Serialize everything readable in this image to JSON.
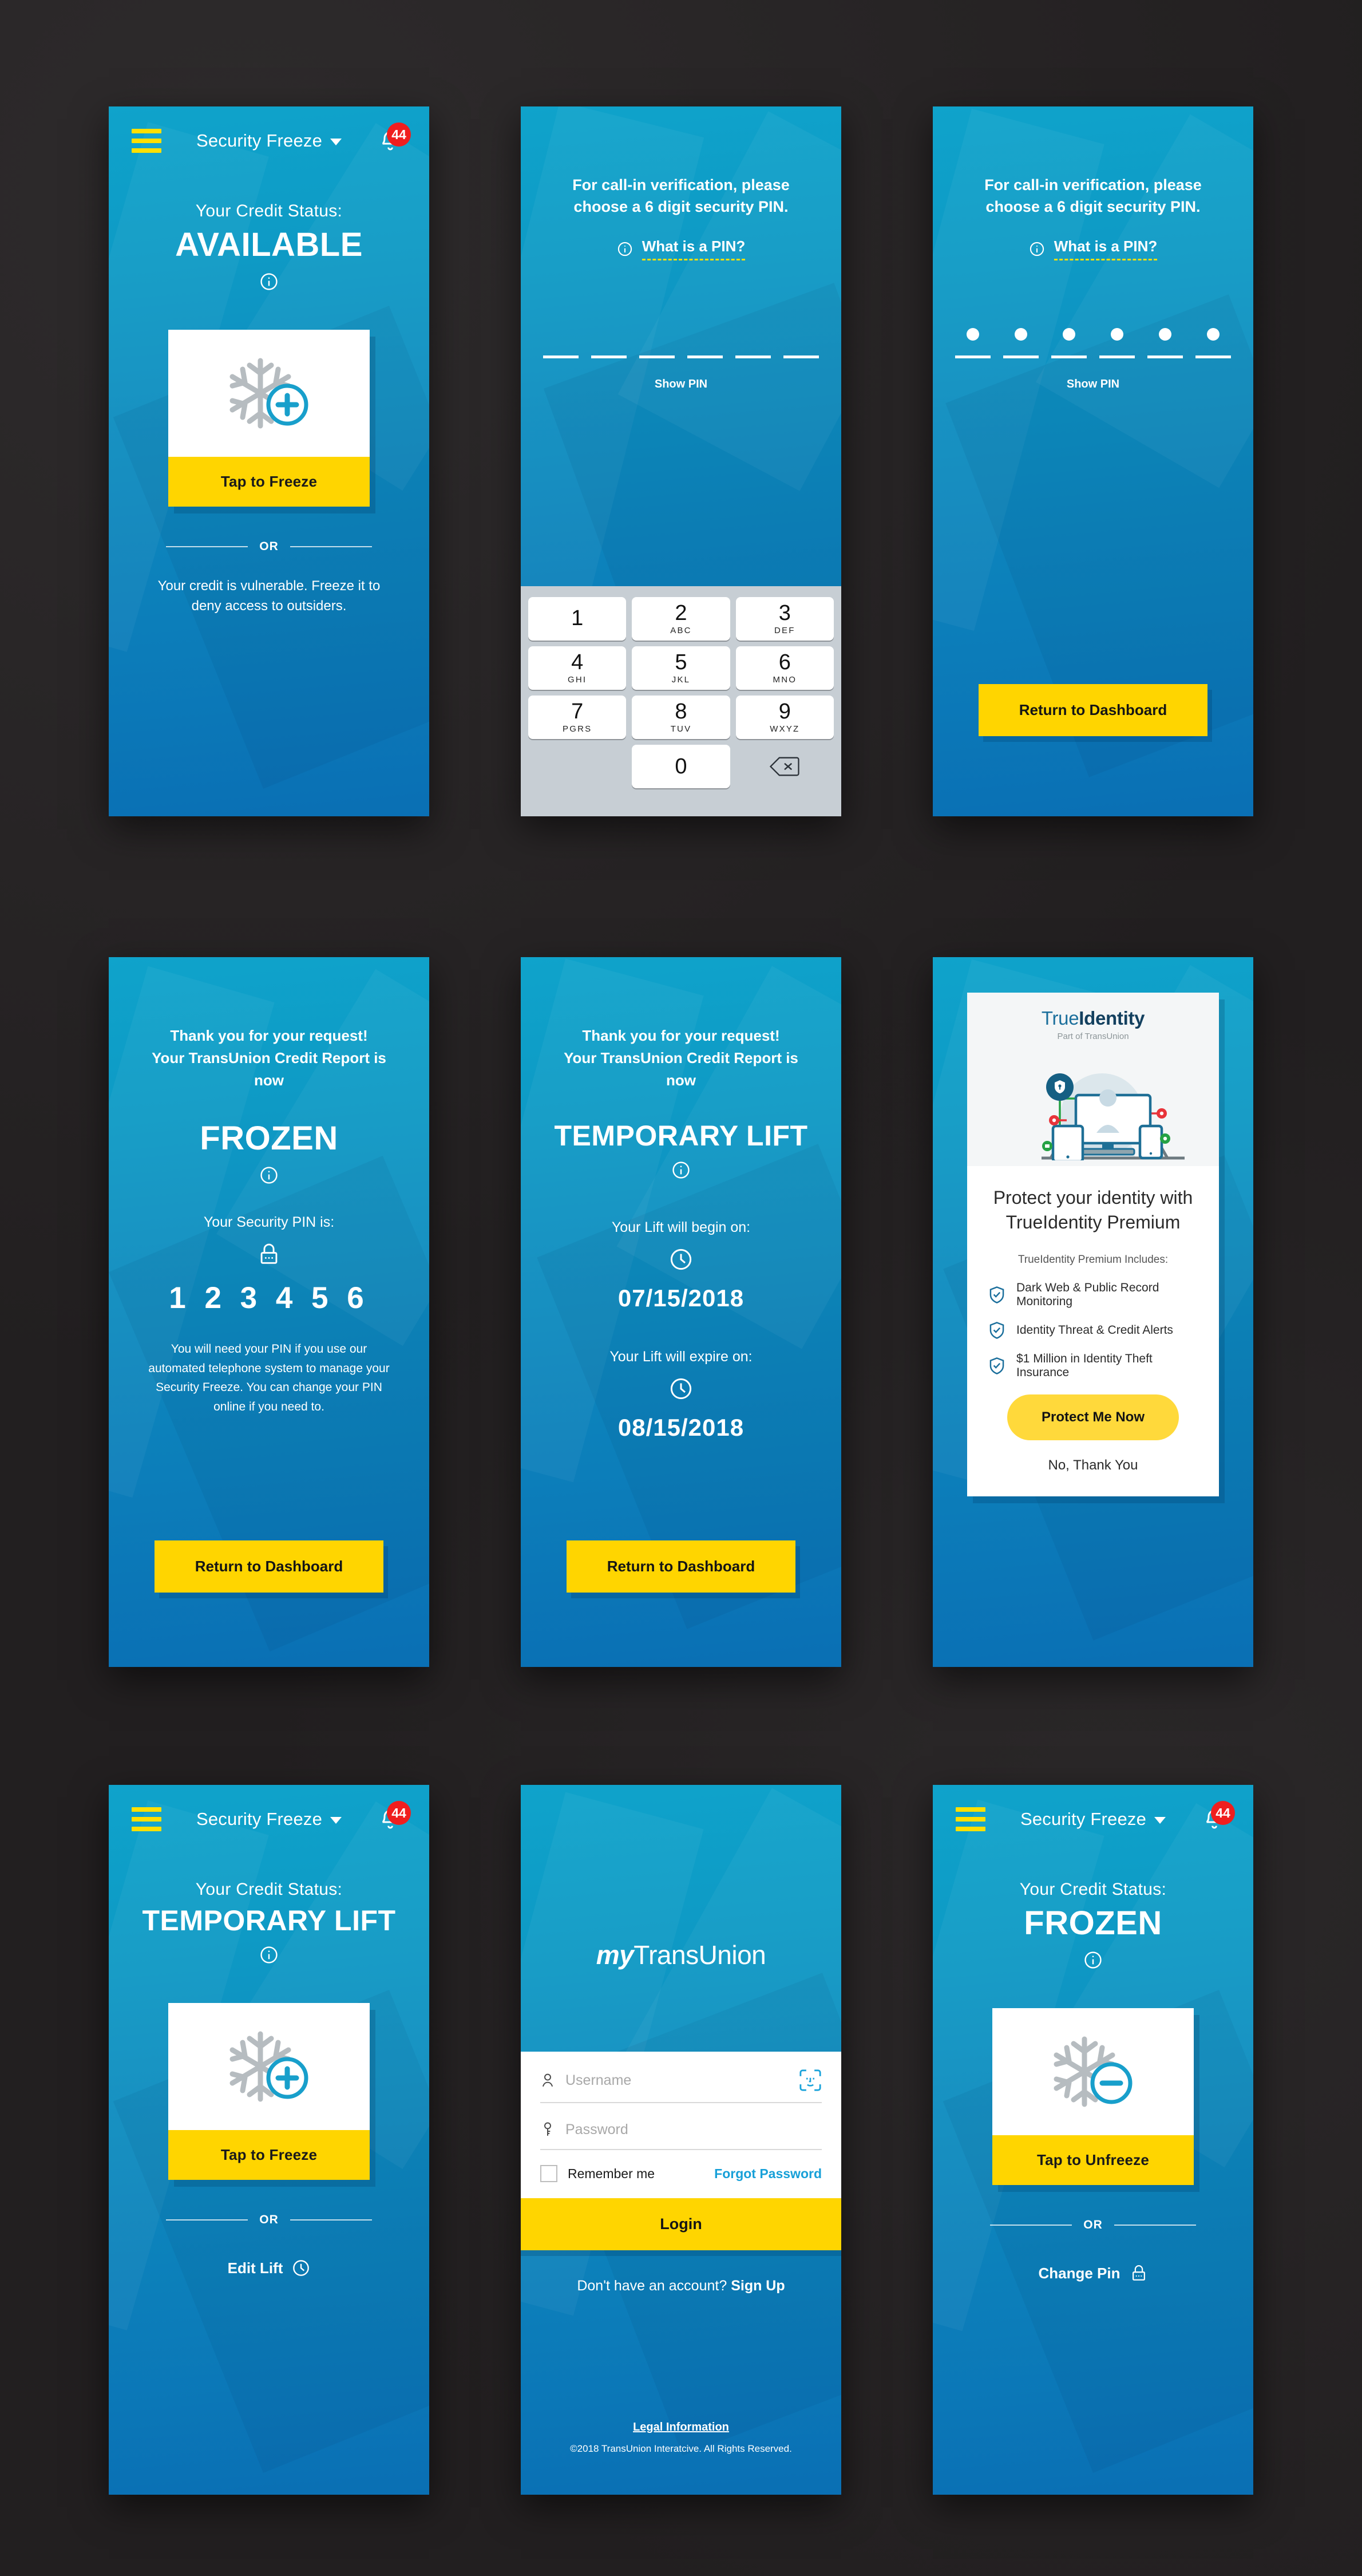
{
  "colors": {
    "teal_top": "#0FA3CB",
    "blue_bottom": "#0A6FB4",
    "yellow": "#FFD500",
    "yellow_menu": "#FFE000",
    "badge_red": "#F01E1E",
    "link_blue": "#17A0D8"
  },
  "nav": {
    "title": "Security Freeze",
    "menu_icon": "hamburger-icon",
    "caret_icon": "chevron-down-icon",
    "bell_icon": "bell-icon",
    "badge_count": "44"
  },
  "common": {
    "status_label": "Your Credit Status:",
    "or": "OR",
    "info_icon": "info-circle-icon",
    "return_dashboard": "Return to Dashboard",
    "thanks_line1": "Thank you for your request!",
    "thanks_line2": "Your TransUnion Credit Report is now"
  },
  "screens": [
    {
      "id": "available-dashboard",
      "status_value": "AVAILABLE",
      "card_button": "Tap to Freeze",
      "card_icon": "snowflake-plus-icon",
      "hint": "Your credit is vulnerable. Freeze it to deny access to outsiders."
    },
    {
      "id": "pin-entry-keypad",
      "prompt": "For call-in verification, please choose a 6 digit security PIN.",
      "what_is_pin": "What is a PIN?",
      "show_pin": "Show PIN",
      "pin_slots": 6,
      "pin_filled": 0,
      "keypad": [
        {
          "num": "1",
          "sub": ""
        },
        {
          "num": "2",
          "sub": "ABC"
        },
        {
          "num": "3",
          "sub": "DEF"
        },
        {
          "num": "4",
          "sub": "GHI"
        },
        {
          "num": "5",
          "sub": "JKL"
        },
        {
          "num": "6",
          "sub": "MNO"
        },
        {
          "num": "7",
          "sub": "PGRS"
        },
        {
          "num": "8",
          "sub": "TUV"
        },
        {
          "num": "9",
          "sub": "WXYZ"
        },
        {
          "num": "0",
          "sub": ""
        }
      ],
      "delete_icon": "backspace-icon"
    },
    {
      "id": "pin-entered",
      "prompt": "For call-in verification, please choose a 6 digit security PIN.",
      "what_is_pin": "What is a PIN?",
      "show_pin": "Show PIN",
      "pin_slots": 6,
      "pin_filled": 6,
      "button": "Return to Dashboard"
    },
    {
      "id": "frozen-confirmation",
      "status_value": "FROZEN",
      "pin_label": "Your Security PIN is:",
      "pin_icon": "lock-icon",
      "pin_value": "1 2 3 4 5 6",
      "fine_print": "You will need your PIN if you use our automated telephone system to manage your Security Freeze. You can change your PIN online if you need to.",
      "button": "Return to Dashboard"
    },
    {
      "id": "temporary-lift-confirmation",
      "status_value": "TEMPORARY LIFT",
      "begin_label": "Your Lift will begin on:",
      "begin_date": "07/15/2018",
      "expire_label": "Your Lift will expire on:",
      "expire_date": "08/15/2018",
      "clock_icon": "clock-icon",
      "button": "Return to Dashboard"
    },
    {
      "id": "trueidentity-upsell",
      "logo_light": "True",
      "logo_bold": "Identity",
      "logo_sub": "Part of TransUnion",
      "illustration": "devices-shield-illustration",
      "headline": "Protect your identity with TrueIdentity Premium",
      "includes_label": "TrueIdentity Premium Includes:",
      "features": [
        "Dark Web & Public Record Monitoring",
        "Identity Threat & Credit Alerts",
        "$1 Million in Identity Theft Insurance"
      ],
      "feature_icon": "shield-check-icon",
      "cta": "Protect Me Now",
      "decline": "No, Thank You"
    },
    {
      "id": "temporary-lift-dashboard",
      "status_value": "TEMPORARY LIFT",
      "card_button": "Tap to Freeze",
      "card_icon": "snowflake-plus-icon",
      "link": "Edit Lift",
      "link_icon": "clock-icon"
    },
    {
      "id": "login",
      "logo_italic": "my",
      "logo_rest": "TransUnion",
      "username_placeholder": "Username",
      "username_icon": "person-icon",
      "password_placeholder": "Password",
      "password_icon": "key-icon",
      "faceid_icon": "face-id-icon",
      "remember_me": "Remember me",
      "forgot_password": "Forgot Password",
      "login_button": "Login",
      "signup_prompt": "Don't have an account? ",
      "signup_link": "Sign Up",
      "legal": "Legal Information",
      "copyright": "©2018 TransUnion Interatcive. All Rights Reserved."
    },
    {
      "id": "frozen-dashboard",
      "status_value": "FROZEN",
      "card_button": "Tap to Unfreeze",
      "card_icon": "snowflake-minus-icon",
      "link": "Change Pin",
      "link_icon": "lock-icon"
    }
  ]
}
